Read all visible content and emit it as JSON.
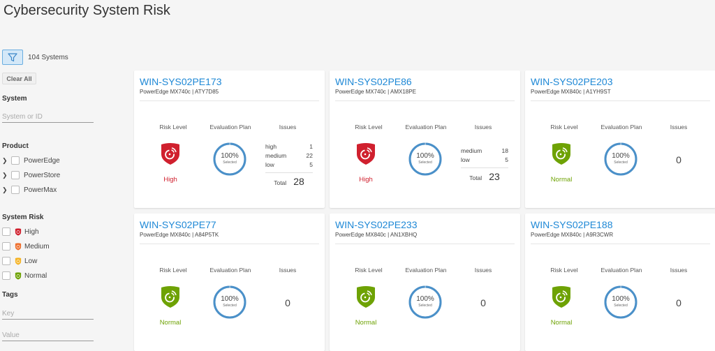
{
  "page_title": "Cybersecurity System Risk",
  "toolbar": {
    "filter_icon": "filter-funnel-icon",
    "systems_count": "104 Systems"
  },
  "sidebar": {
    "clear_all": "Clear All",
    "system": {
      "label": "System",
      "placeholder": "System or ID",
      "value": ""
    },
    "product": {
      "label": "Product",
      "items": [
        {
          "label": "PowerEdge",
          "checked": false
        },
        {
          "label": "PowerStore",
          "checked": false
        },
        {
          "label": "PowerMax",
          "checked": false
        }
      ]
    },
    "system_risk": {
      "label": "System Risk",
      "items": [
        {
          "label": "High",
          "color": "#d0202e",
          "checked": false
        },
        {
          "label": "Medium",
          "color": "#ee6f2d",
          "checked": false
        },
        {
          "label": "Low",
          "color": "#f5b324",
          "checked": false
        },
        {
          "label": "Normal",
          "color": "#6ea204",
          "checked": false
        }
      ]
    },
    "tags": {
      "label": "Tags",
      "key_placeholder": "Key",
      "value_placeholder": "Value"
    }
  },
  "colors": {
    "accent": "#1e88d6",
    "high": "#d0202e",
    "normal": "#6ea204",
    "ring": "#4a90c9"
  },
  "card_labels": {
    "risk_level": "Risk Level",
    "evaluation_plan": "Evaluation Plan",
    "issues": "Issues",
    "selected": "Selected",
    "total": "Total"
  },
  "cards": [
    {
      "name": "WIN-SYS02PE173",
      "subtitle": "PowerEdge MX740c | ATY7D85",
      "risk": "High",
      "risk_color": "#d0202e",
      "eval_plan": "100%",
      "eval_fraction": 1.0,
      "issues": [
        {
          "severity": "high",
          "count": "1"
        },
        {
          "severity": "medium",
          "count": "22"
        },
        {
          "severity": "low",
          "count": "5"
        }
      ],
      "total": "28"
    },
    {
      "name": "WIN-SYS02PE86",
      "subtitle": "PowerEdge MX740c | AMX18PE",
      "risk": "High",
      "risk_color": "#d0202e",
      "eval_plan": "100%",
      "eval_fraction": 1.0,
      "issues": [
        {
          "severity": "medium",
          "count": "18"
        },
        {
          "severity": "low",
          "count": "5"
        }
      ],
      "total": "23"
    },
    {
      "name": "WIN-SYS02PE203",
      "subtitle": "PowerEdge MX840c | A1YH9ST",
      "risk": "Normal",
      "risk_color": "#6ea204",
      "eval_plan": "100%",
      "eval_fraction": 1.0,
      "issues": [],
      "total": "0"
    },
    {
      "name": "WIN-SYS02PE77",
      "subtitle": "PowerEdge MX840c | A84P5TK",
      "risk": "Normal",
      "risk_color": "#6ea204",
      "eval_plan": "100%",
      "eval_fraction": 1.0,
      "issues": [],
      "total": "0"
    },
    {
      "name": "WIN-SYS02PE233",
      "subtitle": "PowerEdge MX840c | AN1XBHQ",
      "risk": "Normal",
      "risk_color": "#6ea204",
      "eval_plan": "100%",
      "eval_fraction": 1.0,
      "issues": [],
      "total": "0"
    },
    {
      "name": "WIN-SYS02PE188",
      "subtitle": "PowerEdge MX840c | A9R3CWR",
      "risk": "Normal",
      "risk_color": "#6ea204",
      "eval_plan": "100%",
      "eval_fraction": 1.0,
      "issues": [],
      "total": "0"
    }
  ]
}
